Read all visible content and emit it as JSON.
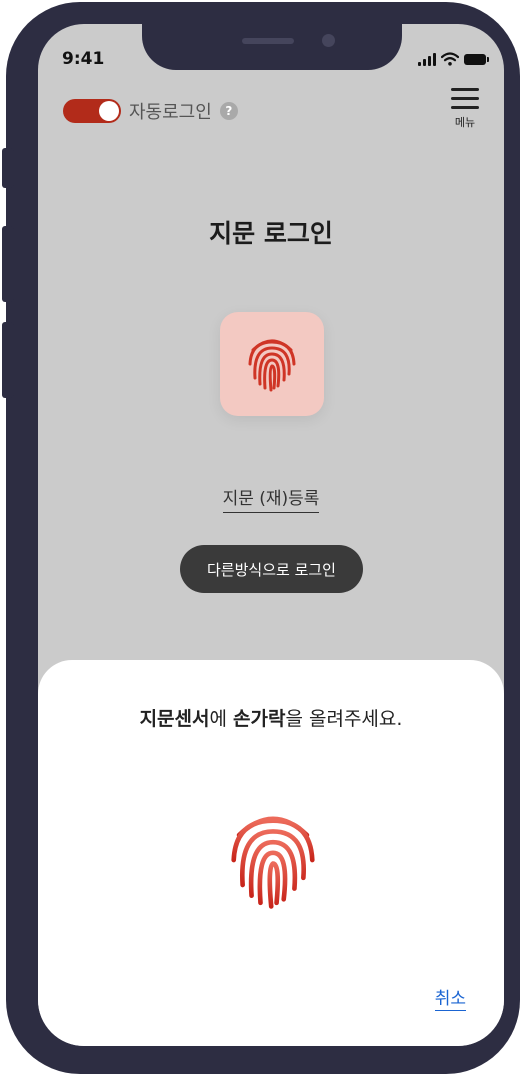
{
  "status_bar": {
    "time": "9:41"
  },
  "auto_login": {
    "label": "자동로그인",
    "enabled": true,
    "help_glyph": "?"
  },
  "menu": {
    "label": "메뉴"
  },
  "title": "지문 로그인",
  "register_link": "지문 (재)등록",
  "other_method_button": "다른방식으로 로그인",
  "sheet": {
    "message_parts": [
      "지문센서",
      "에 ",
      "손가락",
      "을 올려주세요."
    ],
    "cancel": "취소"
  },
  "colors": {
    "accent": "#b22b1a",
    "fingerprint": "#d7392b",
    "link": "#1a64d2"
  }
}
